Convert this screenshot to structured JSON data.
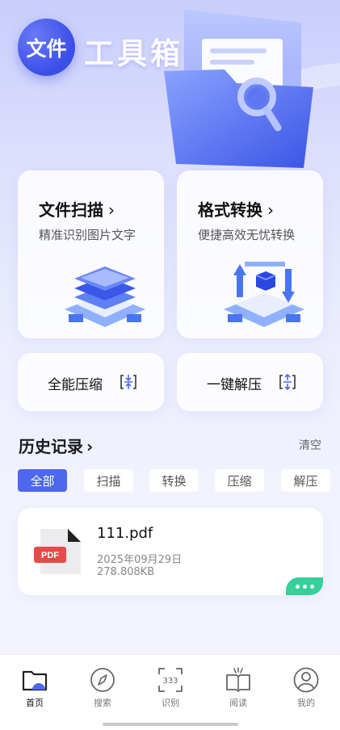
{
  "header": {
    "logo_badge": "文件",
    "logo_text": "工具箱"
  },
  "features": {
    "scan": {
      "title": "文件扫描",
      "subtitle": "精准识别图片文字"
    },
    "convert": {
      "title": "格式转换",
      "subtitle": "便捷高效无忧转换"
    },
    "compress": {
      "label": "全能压缩"
    },
    "extract": {
      "label": "一键解压"
    }
  },
  "history": {
    "title": "历史记录",
    "clear_label": "清空",
    "filters": [
      "全部",
      "扫描",
      "转换",
      "压缩",
      "解压"
    ],
    "active_filter": "全部",
    "files": [
      {
        "name": "111.pdf",
        "date": "2025年09月29日",
        "size": "278.808KB",
        "type_badge": "PDF"
      }
    ]
  },
  "tabbar": {
    "items": [
      {
        "label": "首页",
        "icon": "home-folder-icon"
      },
      {
        "label": "搜索",
        "icon": "compass-icon"
      },
      {
        "label": "识别",
        "icon": "scan-text-icon"
      },
      {
        "label": "阅读",
        "icon": "book-icon"
      },
      {
        "label": "我的",
        "icon": "user-icon"
      }
    ],
    "active": "首页"
  },
  "colors": {
    "accent": "#4d68ee",
    "more_button": "#37cf9a",
    "pdf_badge": "#e84a4a"
  }
}
